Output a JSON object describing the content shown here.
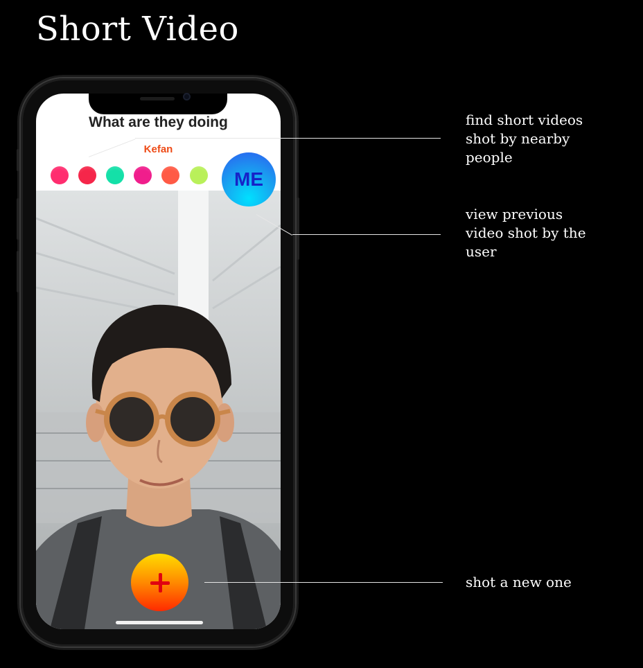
{
  "page": {
    "title": "Short Video"
  },
  "app": {
    "header": "What are they doing",
    "current_user": "Kefan",
    "me_label": "ME",
    "nearby_colors": [
      "#ff2d6f",
      "#f5264a",
      "#14e0a8",
      "#f01e8c",
      "#ff5a45",
      "#b9f05a"
    ]
  },
  "annotations": {
    "nearby": [
      "find short videos",
      "shot by nearby",
      "people"
    ],
    "previous": [
      "view previous",
      "video shot by the",
      "user"
    ],
    "new": [
      "shot a new one"
    ]
  }
}
